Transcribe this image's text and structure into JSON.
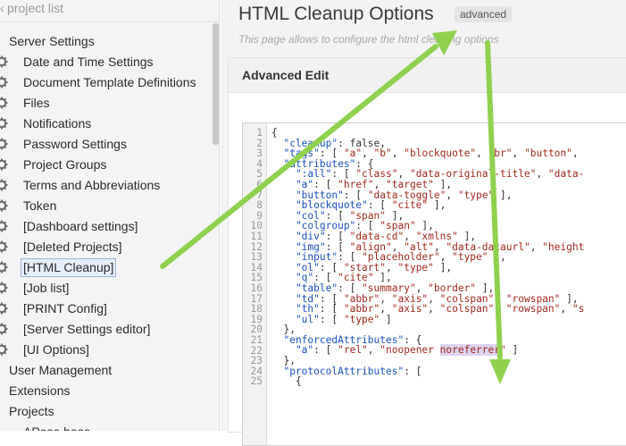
{
  "sidebar": {
    "back_label": "project list",
    "items": [
      {
        "label": "Server Settings",
        "level": "top",
        "gear": false
      },
      {
        "label": "Date and Time Settings",
        "level": "sub",
        "gear": true
      },
      {
        "label": "Document Template Definitions",
        "level": "sub",
        "gear": true
      },
      {
        "label": "Files",
        "level": "sub",
        "gear": true
      },
      {
        "label": "Notifications",
        "level": "sub",
        "gear": true
      },
      {
        "label": "Password Settings",
        "level": "sub",
        "gear": true
      },
      {
        "label": "Project Groups",
        "level": "sub",
        "gear": true
      },
      {
        "label": "Terms and Abbreviations",
        "level": "sub",
        "gear": true
      },
      {
        "label": "Token",
        "level": "sub",
        "gear": true
      },
      {
        "label": "[Dashboard settings]",
        "level": "sub",
        "gear": true
      },
      {
        "label": "[Deleted Projects]",
        "level": "sub",
        "gear": true
      },
      {
        "label": "[HTML Cleanup]",
        "level": "sub",
        "gear": true,
        "active": true
      },
      {
        "label": "[Job list]",
        "level": "sub",
        "gear": true
      },
      {
        "label": "[PRINT Config]",
        "level": "sub",
        "gear": true
      },
      {
        "label": "[Server Settings editor]",
        "level": "sub",
        "gear": true
      },
      {
        "label": "[UI Options]",
        "level": "sub",
        "gear": true
      },
      {
        "label": "User Management",
        "level": "top",
        "gear": false
      },
      {
        "label": "Extensions",
        "level": "top",
        "gear": false
      },
      {
        "label": "Projects",
        "level": "top",
        "gear": false
      },
      {
        "label": "APose base",
        "level": "sub",
        "gear": false
      }
    ]
  },
  "header": {
    "title": "HTML Cleanup Options",
    "badge": "advanced",
    "subtitle": "This page allows to configure the html cleaning options"
  },
  "panel": {
    "title": "Advanced Edit"
  },
  "editor": {
    "line_numbers": [
      "1",
      "2",
      "3",
      "4",
      "5",
      "6",
      "7",
      "8",
      "9",
      "10",
      "11",
      "12",
      "13",
      "14",
      "15",
      "16",
      "17",
      "18",
      "19",
      "20",
      "21",
      "22",
      "23",
      "24",
      "25"
    ],
    "lines": [
      [
        {
          "t": "{",
          "c": "k"
        }
      ],
      [
        {
          "t": "  \"cleanup\"",
          "c": "b"
        },
        {
          "t": ": ",
          "c": "k"
        },
        {
          "t": "false",
          "c": "k"
        },
        {
          "t": ",",
          "c": "k"
        }
      ],
      [
        {
          "t": "  \"tags\"",
          "c": "b"
        },
        {
          "t": ": [ ",
          "c": "k"
        },
        {
          "t": "\"a\"",
          "c": "s"
        },
        {
          "t": ", ",
          "c": "k"
        },
        {
          "t": "\"b\"",
          "c": "s"
        },
        {
          "t": ", ",
          "c": "k"
        },
        {
          "t": "\"blockquote\"",
          "c": "s"
        },
        {
          "t": ", ",
          "c": "k"
        },
        {
          "t": "\"br\"",
          "c": "s"
        },
        {
          "t": ", ",
          "c": "k"
        },
        {
          "t": "\"button\"",
          "c": "s"
        },
        {
          "t": ",",
          "c": "k"
        }
      ],
      [
        {
          "t": "  \"attributes\"",
          "c": "b"
        },
        {
          "t": ": {",
          "c": "k"
        }
      ],
      [
        {
          "t": "    \":all\"",
          "c": "b"
        },
        {
          "t": ": [ ",
          "c": "k"
        },
        {
          "t": "\"class\"",
          "c": "s"
        },
        {
          "t": ", ",
          "c": "k"
        },
        {
          "t": "\"data-original-title\"",
          "c": "s"
        },
        {
          "t": ", ",
          "c": "k"
        },
        {
          "t": "\"data-",
          "c": "s"
        }
      ],
      [
        {
          "t": "    \"a\"",
          "c": "b"
        },
        {
          "t": ": [ ",
          "c": "k"
        },
        {
          "t": "\"href\"",
          "c": "s"
        },
        {
          "t": ", ",
          "c": "k"
        },
        {
          "t": "\"target\"",
          "c": "s"
        },
        {
          "t": " ],",
          "c": "k"
        }
      ],
      [
        {
          "t": "    \"button\"",
          "c": "b"
        },
        {
          "t": ": [ ",
          "c": "k"
        },
        {
          "t": "\"data-toggle\"",
          "c": "s"
        },
        {
          "t": ", ",
          "c": "k"
        },
        {
          "t": "\"type\"",
          "c": "s"
        },
        {
          "t": " ],",
          "c": "k"
        }
      ],
      [
        {
          "t": "    \"blockquote\"",
          "c": "b"
        },
        {
          "t": ": [ ",
          "c": "k"
        },
        {
          "t": "\"cite\"",
          "c": "s"
        },
        {
          "t": " ],",
          "c": "k"
        }
      ],
      [
        {
          "t": "    \"col\"",
          "c": "b"
        },
        {
          "t": ": [ ",
          "c": "k"
        },
        {
          "t": "\"span\"",
          "c": "s"
        },
        {
          "t": " ],",
          "c": "k"
        }
      ],
      [
        {
          "t": "    \"colgroup\"",
          "c": "b"
        },
        {
          "t": ": [ ",
          "c": "k"
        },
        {
          "t": "\"span\"",
          "c": "s"
        },
        {
          "t": " ],",
          "c": "k"
        }
      ],
      [
        {
          "t": "    \"div\"",
          "c": "b"
        },
        {
          "t": ": [ ",
          "c": "k"
        },
        {
          "t": "\"data-cd\"",
          "c": "s"
        },
        {
          "t": ", ",
          "c": "k"
        },
        {
          "t": "\"xmlns\"",
          "c": "s"
        },
        {
          "t": " ],",
          "c": "k"
        }
      ],
      [
        {
          "t": "    \"img\"",
          "c": "b"
        },
        {
          "t": ": [ ",
          "c": "k"
        },
        {
          "t": "\"align\"",
          "c": "s"
        },
        {
          "t": ", ",
          "c": "k"
        },
        {
          "t": "\"alt\"",
          "c": "s"
        },
        {
          "t": ", ",
          "c": "k"
        },
        {
          "t": "\"data-dataurl\"",
          "c": "s"
        },
        {
          "t": ", ",
          "c": "k"
        },
        {
          "t": "\"height",
          "c": "s"
        }
      ],
      [
        {
          "t": "    \"input\"",
          "c": "b"
        },
        {
          "t": ": [ ",
          "c": "k"
        },
        {
          "t": "\"placeholder\"",
          "c": "s"
        },
        {
          "t": ", ",
          "c": "k"
        },
        {
          "t": "\"type\"",
          "c": "s"
        },
        {
          "t": " ],",
          "c": "k"
        }
      ],
      [
        {
          "t": "    \"ol\"",
          "c": "b"
        },
        {
          "t": ": [ ",
          "c": "k"
        },
        {
          "t": "\"start\"",
          "c": "s"
        },
        {
          "t": ", ",
          "c": "k"
        },
        {
          "t": "\"type\"",
          "c": "s"
        },
        {
          "t": " ],",
          "c": "k"
        }
      ],
      [
        {
          "t": "    \"q\"",
          "c": "b"
        },
        {
          "t": ": [ ",
          "c": "k"
        },
        {
          "t": "\"cite\"",
          "c": "s"
        },
        {
          "t": " ],",
          "c": "k"
        }
      ],
      [
        {
          "t": "    \"table\"",
          "c": "b"
        },
        {
          "t": ": [ ",
          "c": "k"
        },
        {
          "t": "\"summary\"",
          "c": "s"
        },
        {
          "t": ", ",
          "c": "k"
        },
        {
          "t": "\"border\"",
          "c": "s"
        },
        {
          "t": " ],",
          "c": "k"
        }
      ],
      [
        {
          "t": "    \"td\"",
          "c": "b"
        },
        {
          "t": ": [ ",
          "c": "k"
        },
        {
          "t": "\"abbr\"",
          "c": "s"
        },
        {
          "t": ", ",
          "c": "k"
        },
        {
          "t": "\"axis\"",
          "c": "s"
        },
        {
          "t": ", ",
          "c": "k"
        },
        {
          "t": "\"colspan\"",
          "c": "s"
        },
        {
          "t": ", ",
          "c": "k"
        },
        {
          "t": "\"rowspan\"",
          "c": "s"
        },
        {
          "t": " ],",
          "c": "k"
        }
      ],
      [
        {
          "t": "    \"th\"",
          "c": "b"
        },
        {
          "t": ": [ ",
          "c": "k"
        },
        {
          "t": "\"abbr\"",
          "c": "s"
        },
        {
          "t": ", ",
          "c": "k"
        },
        {
          "t": "\"axis\"",
          "c": "s"
        },
        {
          "t": ", ",
          "c": "k"
        },
        {
          "t": "\"colspan\"",
          "c": "s"
        },
        {
          "t": ", ",
          "c": "k"
        },
        {
          "t": "\"rowspan\"",
          "c": "s"
        },
        {
          "t": ", ",
          "c": "k"
        },
        {
          "t": "\"s",
          "c": "s"
        }
      ],
      [
        {
          "t": "    \"ul\"",
          "c": "b"
        },
        {
          "t": ": [ ",
          "c": "k"
        },
        {
          "t": "\"type\"",
          "c": "s"
        },
        {
          "t": " ]",
          "c": "k"
        }
      ],
      [
        {
          "t": "  },",
          "c": "k"
        }
      ],
      [
        {
          "t": "  \"enforcedAttributes\"",
          "c": "b"
        },
        {
          "t": ": {",
          "c": "k"
        }
      ],
      [
        {
          "t": "    \"a\"",
          "c": "b"
        },
        {
          "t": ": [ ",
          "c": "k"
        },
        {
          "t": "\"rel\"",
          "c": "s"
        },
        {
          "t": ", ",
          "c": "k"
        },
        {
          "t": "\"noopener ",
          "c": "s"
        },
        {
          "t": "noreferrer",
          "c": "hl"
        },
        {
          "t": "\"",
          "c": "s"
        },
        {
          "t": " ]",
          "c": "k"
        }
      ],
      [
        {
          "t": "  },",
          "c": "k"
        }
      ],
      [
        {
          "t": "  \"protocolAttributes\"",
          "c": "b"
        },
        {
          "t": ": [",
          "c": "k"
        }
      ],
      [
        {
          "t": "    {",
          "c": "k"
        }
      ]
    ]
  },
  "colors": {
    "arrow": "#8fd14f",
    "sidebar_bg": "#f4f4f4",
    "string": "#a2281d",
    "key": "#1a4fc0"
  }
}
